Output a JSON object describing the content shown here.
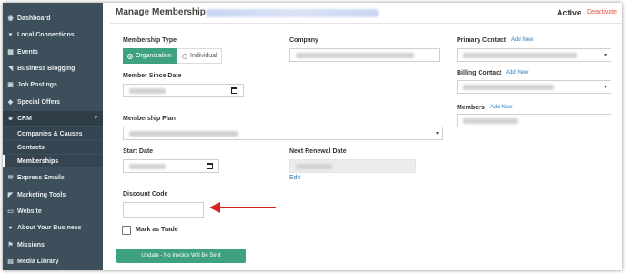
{
  "sidebar": {
    "items": [
      {
        "label": "Dashboard",
        "icon": "dashboard-icon",
        "glyph": "◉"
      },
      {
        "label": "Local Connections",
        "icon": "heart-icon",
        "glyph": "♥"
      },
      {
        "label": "Events",
        "icon": "calendar-icon",
        "glyph": "▦"
      },
      {
        "label": "Business Blogging",
        "icon": "rss-icon",
        "glyph": "◥"
      },
      {
        "label": "Job Postings",
        "icon": "briefcase-icon",
        "glyph": "▣"
      },
      {
        "label": "Special Offers",
        "icon": "tag-icon",
        "glyph": "◆"
      },
      {
        "label": "CRM",
        "icon": "users-icon",
        "glyph": "☻",
        "caret": "˅"
      },
      {
        "label": "Express Emails",
        "icon": "envelope-icon",
        "glyph": "✉"
      },
      {
        "label": "Marketing Tools",
        "icon": "megaphone-icon",
        "glyph": "◤"
      },
      {
        "label": "Website",
        "icon": "globe-icon",
        "glyph": "▭"
      },
      {
        "label": "About Your Business",
        "icon": "info-icon",
        "glyph": "●"
      },
      {
        "label": "Missions",
        "icon": "flag-icon",
        "glyph": "⚑"
      },
      {
        "label": "Media Library",
        "icon": "image-icon",
        "glyph": "▤"
      }
    ],
    "crm_sub": [
      {
        "label": "Companies & Causes"
      },
      {
        "label": "Contacts"
      },
      {
        "label": "Memberships"
      }
    ]
  },
  "header": {
    "title": "Manage Membership -",
    "status": "Active",
    "deactivate": "Deactivate"
  },
  "form": {
    "membership_type": {
      "label": "Membership Type",
      "options": [
        "Organization",
        "Individual"
      ],
      "selected": "Organization"
    },
    "company_label": "Company",
    "member_since_label": "Member Since Date",
    "membership_plan_label": "Membership Plan",
    "start_date_label": "Start Date",
    "next_renewal_label": "Next Renewal Date",
    "edit_link": "Edit",
    "discount_code_label": "Discount Code",
    "discount_code_value": "",
    "mark_as_trade_label": "Mark as Trade",
    "primary_contact_label": "Primary Contact",
    "billing_contact_label": "Billing Contact",
    "members_label": "Members",
    "add_new": "Add New",
    "update_button": "Update - No Invoice Will Be Sent"
  },
  "colors": {
    "sidebar_bg": "#3e4f5c",
    "accent_green": "#3fa27e",
    "link_blue": "#2a7ab8",
    "deactivate_red": "#e24a3b",
    "arrow_red": "#d9231c"
  }
}
